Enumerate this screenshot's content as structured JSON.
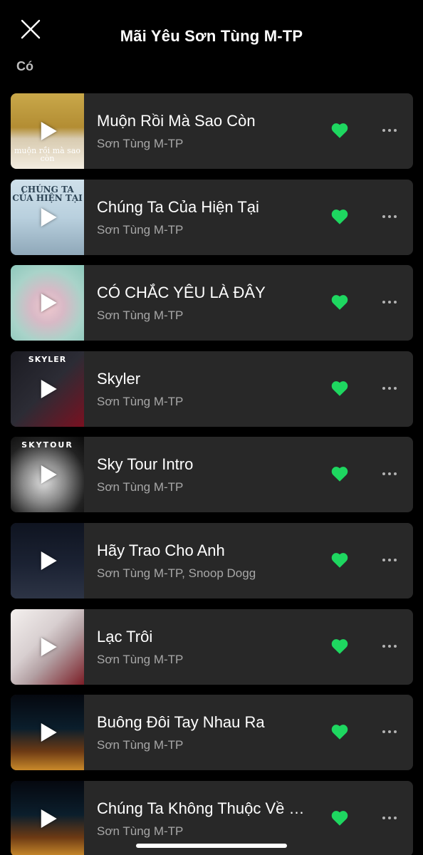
{
  "header": {
    "title": "Mãi Yêu Sơn Tùng M-TP",
    "filter_label": "Có"
  },
  "colors": {
    "background": "#000000",
    "row_background": "#282828",
    "liked_heart": "#1ed760",
    "secondary_text": "#a7a7a7"
  },
  "songs": [
    {
      "title": "Muộn Rồi Mà Sao Còn",
      "artist": "Sơn Tùng M-TP",
      "liked": true,
      "cover_text": "muộn rồi mà sao còn"
    },
    {
      "title": "Chúng Ta Của Hiện Tại",
      "artist": "Sơn Tùng M-TP",
      "liked": true,
      "cover_text": "CHÚNG TA CỦA HIỆN TẠI"
    },
    {
      "title": "CÓ CHẮC YÊU LÀ ĐÂY",
      "artist": "Sơn Tùng M-TP",
      "liked": true,
      "cover_text": ""
    },
    {
      "title": "Skyler",
      "artist": "Sơn Tùng M-TP",
      "liked": true,
      "cover_text": "SKYLER"
    },
    {
      "title": "Sky Tour Intro",
      "artist": "Sơn Tùng M-TP",
      "liked": true,
      "cover_text": "SKYTOUR"
    },
    {
      "title": "Hãy Trao Cho Anh",
      "artist": "Sơn Tùng M-TP, Snoop Dogg",
      "liked": true,
      "cover_text": ""
    },
    {
      "title": "Lạc Trôi",
      "artist": "Sơn Tùng M-TP",
      "liked": true,
      "cover_text": ""
    },
    {
      "title": "Buông Đôi Tay Nhau Ra",
      "artist": "Sơn Tùng M-TP",
      "liked": true,
      "cover_text": ""
    },
    {
      "title": "Chúng Ta Không Thuộc Về Nhau",
      "artist": "Sơn Tùng M-TP",
      "liked": true,
      "cover_text": ""
    }
  ]
}
